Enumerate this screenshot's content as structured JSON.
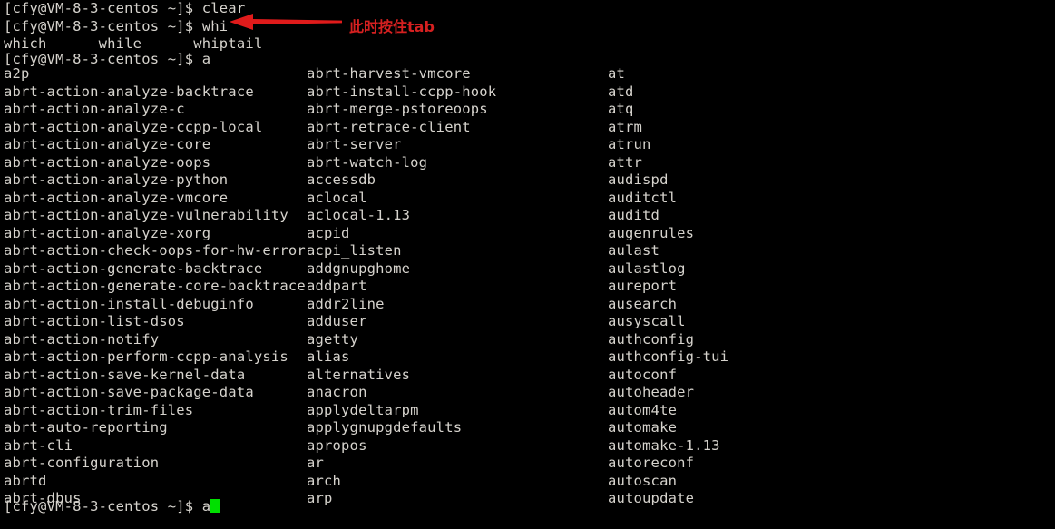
{
  "terminal": {
    "background_color": "#000000",
    "foreground_color": "#d6d3cd",
    "cursor_color": "#00e000",
    "prompt": "[cfy@VM-8-3-centos ~]$ ",
    "lines": [
      {
        "prompt": "[cfy@VM-8-3-centos ~]$ ",
        "command": "clear"
      },
      {
        "prompt": "[cfy@VM-8-3-centos ~]$ ",
        "command": "whi"
      }
    ],
    "whi_completions_line": "which      while      whiptail",
    "a_prompt_line": "[cfy@VM-8-3-centos ~]$ a",
    "final_prompt_line": "[cfy@VM-8-3-centos ~]$ a",
    "completion_columns": {
      "column1": [
        "a2p",
        "abrt-action-analyze-backtrace",
        "abrt-action-analyze-c",
        "abrt-action-analyze-ccpp-local",
        "abrt-action-analyze-core",
        "abrt-action-analyze-oops",
        "abrt-action-analyze-python",
        "abrt-action-analyze-vmcore",
        "abrt-action-analyze-vulnerability",
        "abrt-action-analyze-xorg",
        "abrt-action-check-oops-for-hw-error",
        "abrt-action-generate-backtrace",
        "abrt-action-generate-core-backtrace",
        "abrt-action-install-debuginfo",
        "abrt-action-list-dsos",
        "abrt-action-notify",
        "abrt-action-perform-ccpp-analysis",
        "abrt-action-save-kernel-data",
        "abrt-action-save-package-data",
        "abrt-action-trim-files",
        "abrt-auto-reporting",
        "abrt-cli",
        "abrt-configuration",
        "abrtd",
        "abrt-dbus"
      ],
      "column2": [
        "abrt-harvest-vmcore",
        "abrt-install-ccpp-hook",
        "abrt-merge-pstoreoops",
        "abrt-retrace-client",
        "abrt-server",
        "abrt-watch-log",
        "accessdb",
        "aclocal",
        "aclocal-1.13",
        "acpid",
        "acpi_listen",
        "addgnupghome",
        "addpart",
        "addr2line",
        "adduser",
        "agetty",
        "alias",
        "alternatives",
        "anacron",
        "applydeltarpm",
        "applygnupgdefaults",
        "apropos",
        "ar",
        "arch",
        "arp"
      ],
      "column3": [
        "at",
        "atd",
        "atq",
        "atrm",
        "atrun",
        "attr",
        "audispd",
        "auditctl",
        "auditd",
        "augenrules",
        "aulast",
        "aulastlog",
        "aureport",
        "ausearch",
        "ausyscall",
        "authconfig",
        "authconfig-tui",
        "autoconf",
        "autoheader",
        "autom4te",
        "automake",
        "automake-1.13",
        "autoreconf",
        "autoscan",
        "autoupdate"
      ]
    }
  },
  "annotation": {
    "text": "此时按住tab",
    "color": "#d52020",
    "arrow_direction": "left"
  }
}
